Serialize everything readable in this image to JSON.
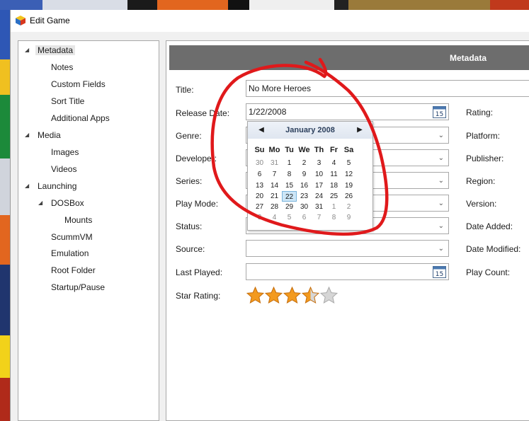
{
  "window": {
    "title": "Edit Game"
  },
  "tree": {
    "items": [
      {
        "label": "Metadata",
        "level": 0,
        "expander": "expanded",
        "selected": true
      },
      {
        "label": "Notes",
        "level": 1
      },
      {
        "label": "Custom Fields",
        "level": 1
      },
      {
        "label": "Sort Title",
        "level": 1
      },
      {
        "label": "Additional Apps",
        "level": 1
      },
      {
        "label": "Media",
        "level": 0,
        "expander": "expanded"
      },
      {
        "label": "Images",
        "level": 1
      },
      {
        "label": "Videos",
        "level": 1
      },
      {
        "label": "Launching",
        "level": 0,
        "expander": "expanded"
      },
      {
        "label": "DOSBox",
        "level": 1,
        "expander": "expanded"
      },
      {
        "label": "Mounts",
        "level": 2
      },
      {
        "label": "ScummVM",
        "level": 1
      },
      {
        "label": "Emulation",
        "level": 1
      },
      {
        "label": "Root Folder",
        "level": 1
      },
      {
        "label": "Startup/Pause",
        "level": 1
      }
    ]
  },
  "header": {
    "title": "Metadata"
  },
  "form": {
    "title_label": "Title:",
    "title_value": "No More Heroes",
    "release_date_label": "Release Date:",
    "release_date_value": "1/22/2008",
    "genre_label": "Genre:",
    "developer_label": "Developer:",
    "series_label": "Series:",
    "play_mode_label": "Play Mode:",
    "status_label": "Status:",
    "source_label": "Source:",
    "last_played_label": "Last Played:",
    "star_rating_label": "Star Rating:",
    "star_rating_value": 3.5,
    "star_rating_max": 5
  },
  "right_labels": {
    "rating": "Rating:",
    "platform": "Platform:",
    "publisher": "Publisher:",
    "region": "Region:",
    "version": "Version:",
    "date_added": "Date Added:",
    "date_modified": "Date Modified:",
    "play_count": "Play Count:"
  },
  "calendar": {
    "month_title": "January 2008",
    "weekdays": [
      "Su",
      "Mo",
      "Tu",
      "We",
      "Th",
      "Fr",
      "Sa"
    ],
    "weeks": [
      [
        "30",
        "31",
        "1",
        "2",
        "3",
        "4",
        "5"
      ],
      [
        "6",
        "7",
        "8",
        "9",
        "10",
        "11",
        "12"
      ],
      [
        "13",
        "14",
        "15",
        "16",
        "17",
        "18",
        "19"
      ],
      [
        "20",
        "21",
        "22",
        "23",
        "24",
        "25",
        "26"
      ],
      [
        "27",
        "28",
        "29",
        "30",
        "31",
        "1",
        "2"
      ],
      [
        "3",
        "4",
        "5",
        "6",
        "7",
        "8",
        "9"
      ]
    ],
    "selected_day": "22",
    "first_week_leading_other": 2,
    "fifth_week_trailing_other": 2,
    "sixth_week_all_other": true
  },
  "colors": {
    "header_bar": "#6d6d6d",
    "selection": "#cde6f7",
    "annotation": "#e0191b",
    "star_fill": "#f39a1e",
    "star_empty": "#d6d6d6"
  }
}
